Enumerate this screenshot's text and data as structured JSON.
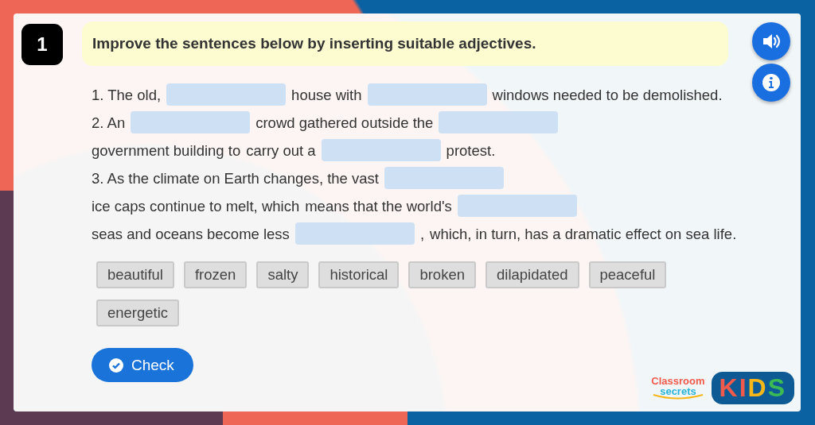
{
  "question_number": "1",
  "instruction": "Improve the sentences below by inserting suitable adjectives.",
  "sentences": [
    [
      {
        "kind": "text",
        "text": "1. The old,"
      },
      {
        "kind": "blank"
      },
      {
        "kind": "text",
        "text": "house with"
      },
      {
        "kind": "blank"
      },
      {
        "kind": "text",
        "text": "windows needed to be demolished."
      }
    ],
    [
      {
        "kind": "text",
        "text": "2. An"
      },
      {
        "kind": "blank"
      },
      {
        "kind": "text",
        "text": "crowd gathered outside the"
      },
      {
        "kind": "blank"
      },
      {
        "kind": "text",
        "text": "government building to"
      },
      {
        "kind": "text",
        "text": "carry out a"
      },
      {
        "kind": "blank"
      },
      {
        "kind": "text",
        "text": "protest."
      }
    ],
    [
      {
        "kind": "text",
        "text": "3. As the climate on Earth changes, the vast"
      },
      {
        "kind": "blank"
      },
      {
        "kind": "text",
        "text": "ice caps continue to melt, which"
      },
      {
        "kind": "text",
        "text": "means that the world's"
      },
      {
        "kind": "blank"
      },
      {
        "kind": "text",
        "text": "seas and oceans become less"
      },
      {
        "kind": "blank"
      },
      {
        "kind": "text",
        "text": ","
      },
      {
        "kind": "text",
        "text": "which, in turn, has a dramatic effect on sea life."
      }
    ]
  ],
  "word_bank": [
    "beautiful",
    "frozen",
    "salty",
    "historical",
    "broken",
    "dilapidated",
    "peaceful",
    "energetic"
  ],
  "check_button": "Check",
  "logo": {
    "brand_lines": [
      "Classroom",
      "secrets"
    ],
    "kids_letters": [
      {
        "text": "K",
        "color": "#f05a4a"
      },
      {
        "text": "I",
        "color": "#f05a4a"
      },
      {
        "text": "D",
        "color": "#f7b718"
      },
      {
        "text": "S",
        "color": "#3cba54"
      }
    ]
  }
}
